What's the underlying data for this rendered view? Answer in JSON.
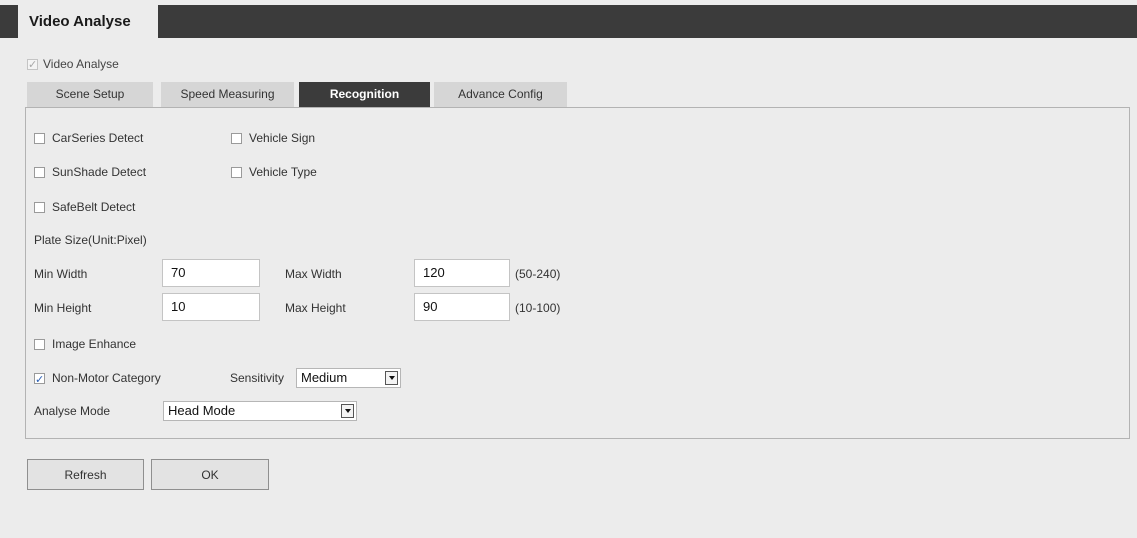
{
  "header": {
    "title": "Video Analyse"
  },
  "enable": {
    "label": "Video Analyse",
    "checked": true
  },
  "tabs": [
    {
      "label": "Scene Setup"
    },
    {
      "label": "Speed Measuring"
    },
    {
      "label": "Recognition"
    },
    {
      "label": "Advance Config"
    }
  ],
  "active_tab": "Recognition",
  "detections": {
    "carseries": "CarSeries Detect",
    "vehicle_sign": "Vehicle Sign",
    "sunshade": "SunShade Detect",
    "vehicle_type": "Vehicle Type",
    "safebelt": "SafeBelt Detect"
  },
  "plate": {
    "section_label": "Plate Size(Unit:Pixel)",
    "min_width_label": "Min Width",
    "min_width": "70",
    "max_width_label": "Max Width",
    "max_width": "120",
    "width_range": "(50-240)",
    "min_height_label": "Min Height",
    "min_height": "10",
    "max_height_label": "Max Height",
    "max_height": "90",
    "height_range": "(10-100)"
  },
  "image_enhance": {
    "label": "Image Enhance",
    "checked": false
  },
  "non_motor": {
    "label": "Non-Motor Category",
    "checked": true
  },
  "sensitivity": {
    "label": "Sensitivity",
    "value": "Medium"
  },
  "analyse_mode": {
    "label": "Analyse Mode",
    "value": "Head Mode"
  },
  "buttons": {
    "refresh": "Refresh",
    "ok": "OK"
  }
}
